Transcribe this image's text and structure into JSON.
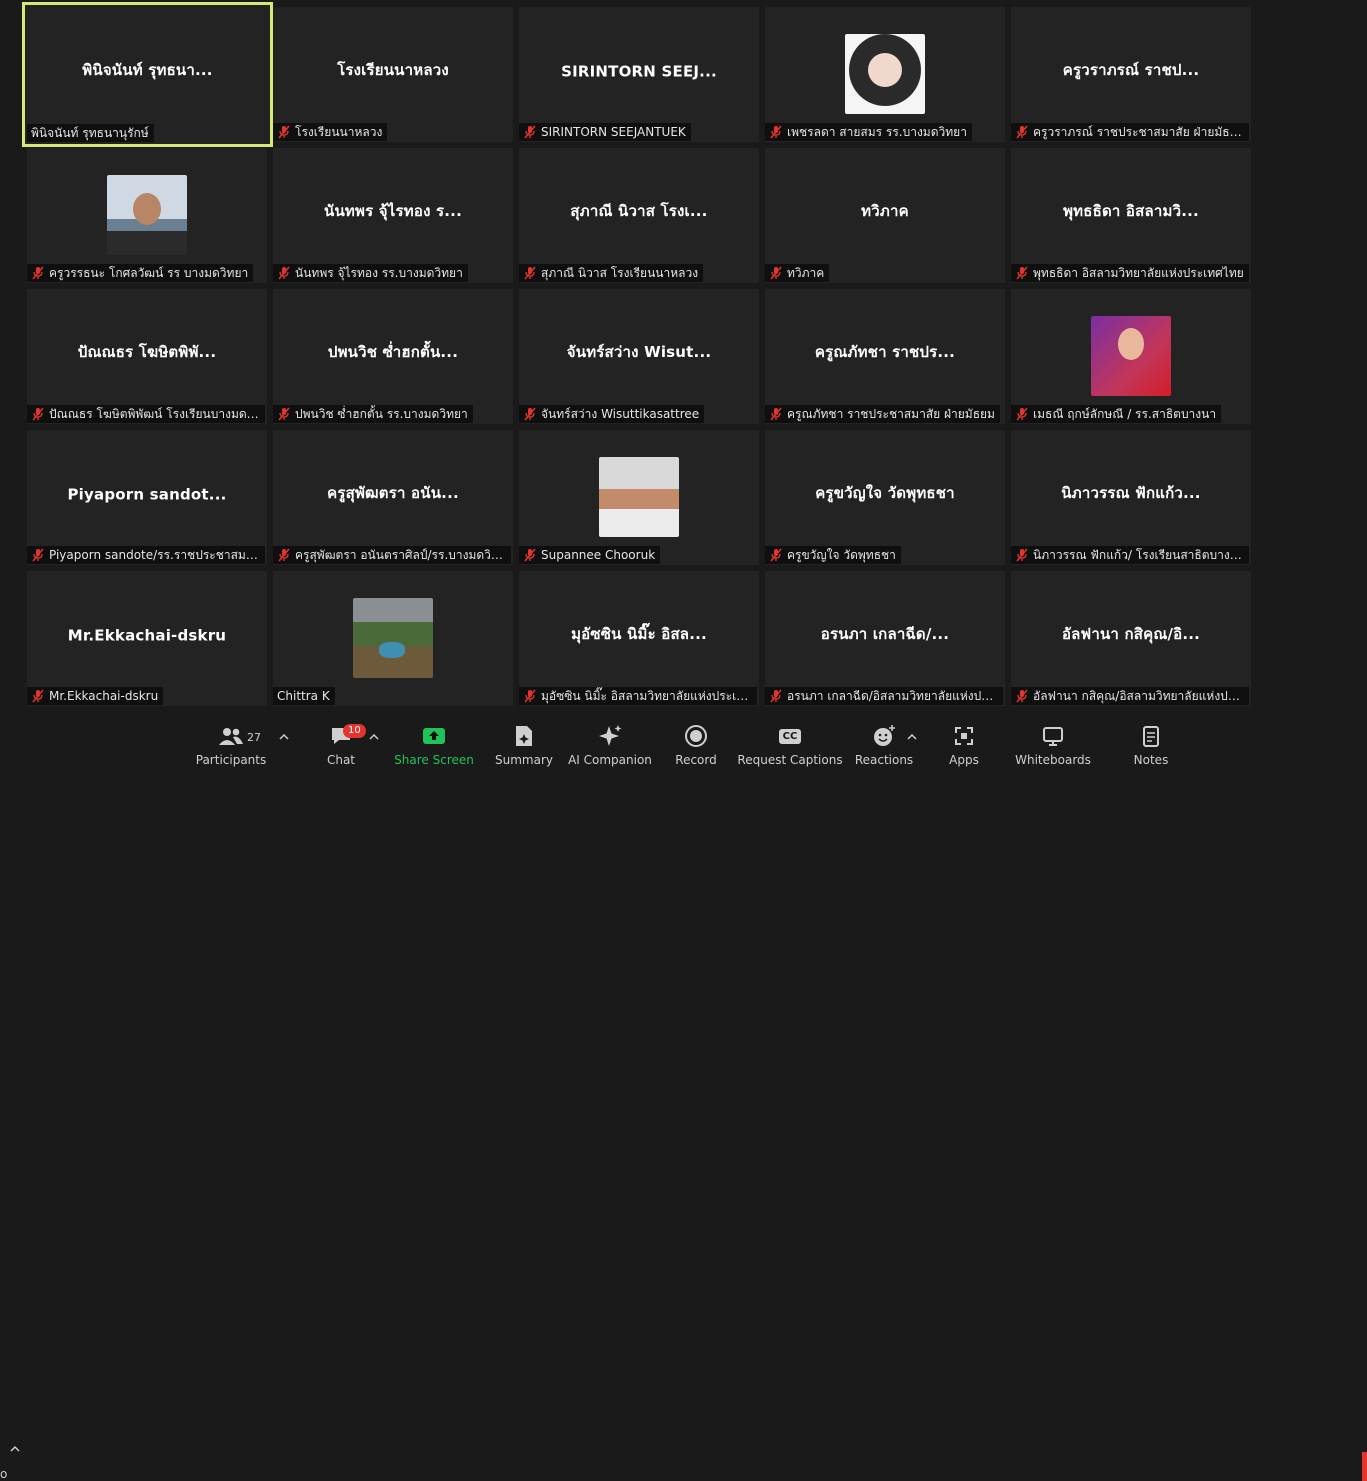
{
  "tiles": [
    {
      "display": "พินิจนันท์ รุทธนา...",
      "tag": "พินิจนันท์ รุทธนานุรักษ์",
      "muted": false,
      "active": true,
      "avatar": ""
    },
    {
      "display": "โรงเรียนนาหลวง",
      "tag": "โรงเรียนนาหลวง",
      "muted": true,
      "avatar": ""
    },
    {
      "display": "SIRINTORN  SEEJ...",
      "tag": "SIRINTORN SEEJANTUEK",
      "muted": true,
      "avatar": ""
    },
    {
      "display": "",
      "tag": "เพชรลดา สายสมร รร.บางมดวิทยา",
      "muted": true,
      "avatar": "av-dog"
    },
    {
      "display": "ครูวราภรณ์ ราชป...",
      "tag": "ครูวราภรณ์ ราชประชาสมาสัย ฝ่ายมัธยมฯ",
      "muted": true,
      "avatar": ""
    },
    {
      "display": "",
      "tag": "ครูวรรธนะ โกศลวัฒน์ รร บางมดวิทยา",
      "muted": true,
      "avatar": "av-boy"
    },
    {
      "display": "นันทพร จุ้ไรทอง ร...",
      "tag": "นันทพร จุ้ไรทอง รร.บางมดวิทยา",
      "muted": true,
      "avatar": ""
    },
    {
      "display": "สุภาณี นิวาส โรงเ...",
      "tag": "สุภาณี นิวาส โรงเรียนนาหลวง",
      "muted": true,
      "avatar": ""
    },
    {
      "display": "ทวิภาค",
      "tag": "ทวิภาค",
      "muted": true,
      "avatar": ""
    },
    {
      "display": "พุทธธิดา อิสลามวิ...",
      "tag": "พุทธธิดา อิสลามวิทยาลัยแห่งประเทศไทย",
      "muted": true,
      "avatar": ""
    },
    {
      "display": "ปัณณธร โฆษิตพิพั...",
      "tag": "ปัณณธร โฆษิตพิพัฒน์ โรงเรียนบางมดวิท...",
      "muted": true,
      "avatar": ""
    },
    {
      "display": "ปพนวิช ซ่ำฮกตั้น...",
      "tag": "ปพนวิช ซ่ำฮกตั้น รร.บางมดวิทยา",
      "muted": true,
      "avatar": ""
    },
    {
      "display": "จันทร์สว่าง Wisut...",
      "tag": "จันทร์สว่าง Wisuttikasattree",
      "muted": true,
      "avatar": ""
    },
    {
      "display": "ครูณภัทชา ราชปร...",
      "tag": "ครูณภัทชา ราชประชาสมาสัย ฝ่ายมัธยม",
      "muted": true,
      "avatar": ""
    },
    {
      "display": "",
      "tag": "เมธณี ฤกษ์ลักษณี / รร.สาธิตบางนา",
      "muted": true,
      "avatar": "av-woman"
    },
    {
      "display": "Piyaporn  sandot...",
      "tag": "Piyaporn sandote/รร.ราชประชาสมาสั...",
      "muted": true,
      "avatar": ""
    },
    {
      "display": "ครูสุพัฒตรา อนัน...",
      "tag": "ครูสุพัฒตรา อนันตราศิลป์/รร.บางมดวิทย...",
      "muted": true,
      "avatar": ""
    },
    {
      "display": "",
      "tag": "Supannee Chooruk",
      "muted": true,
      "avatar": "av-kids"
    },
    {
      "display": "ครูขวัญใจ วัดพุทธชา",
      "tag": "ครูขวัญใจ วัดพุทธชา",
      "muted": true,
      "avatar": ""
    },
    {
      "display": "นิภาวรรณ ฟักแก้ว...",
      "tag": "นิภาวรรณ ฟักแก้ว/ โรงเรียนสาธิตบางนา",
      "muted": true,
      "avatar": ""
    },
    {
      "display": "Mr.Ekkachai-dskru",
      "tag": "Mr.Ekkachai-dskru",
      "muted": true,
      "avatar": ""
    },
    {
      "display": "",
      "tag": "Chittra K",
      "muted": false,
      "avatar": "av-field"
    },
    {
      "display": "มุอัซซิน นิมิ๊ะ อิสล...",
      "tag": "มุอัซซิน นิมิ๊ะ อิสลามวิทยาลัยแห่งประเทศไทย",
      "muted": true,
      "avatar": ""
    },
    {
      "display": "อรนภา  เกลาฉีด/...",
      "tag": "อรนภา  เกลาฉีด/อิสลามวิทยาลัยแห่งประ...",
      "muted": true,
      "avatar": ""
    },
    {
      "display": "อัลฟานา กสิคุณ/อิ...",
      "tag": "อัลฟานา กสิคุณ/อิสลามวิทยาลัยแห่งประ...",
      "muted": true,
      "avatar": ""
    }
  ],
  "toolbar": {
    "edge_label": "o",
    "participants": {
      "label": "Participants",
      "count": "27"
    },
    "chat": {
      "label": "Chat",
      "badge": "10"
    },
    "share": {
      "label": "Share Screen"
    },
    "summary": {
      "label": "Summary"
    },
    "ai": {
      "label": "AI Companion"
    },
    "record": {
      "label": "Record"
    },
    "captions": {
      "label": "Request Captions",
      "icon_text": "CC"
    },
    "reactions": {
      "label": "Reactions"
    },
    "apps": {
      "label": "Apps"
    },
    "whiteboards": {
      "label": "Whiteboards"
    },
    "notes": {
      "label": "Notes"
    }
  },
  "colors": {
    "active_border": "#d5e979",
    "muted_icon": "#e5342e",
    "share_green": "#20c25a"
  }
}
